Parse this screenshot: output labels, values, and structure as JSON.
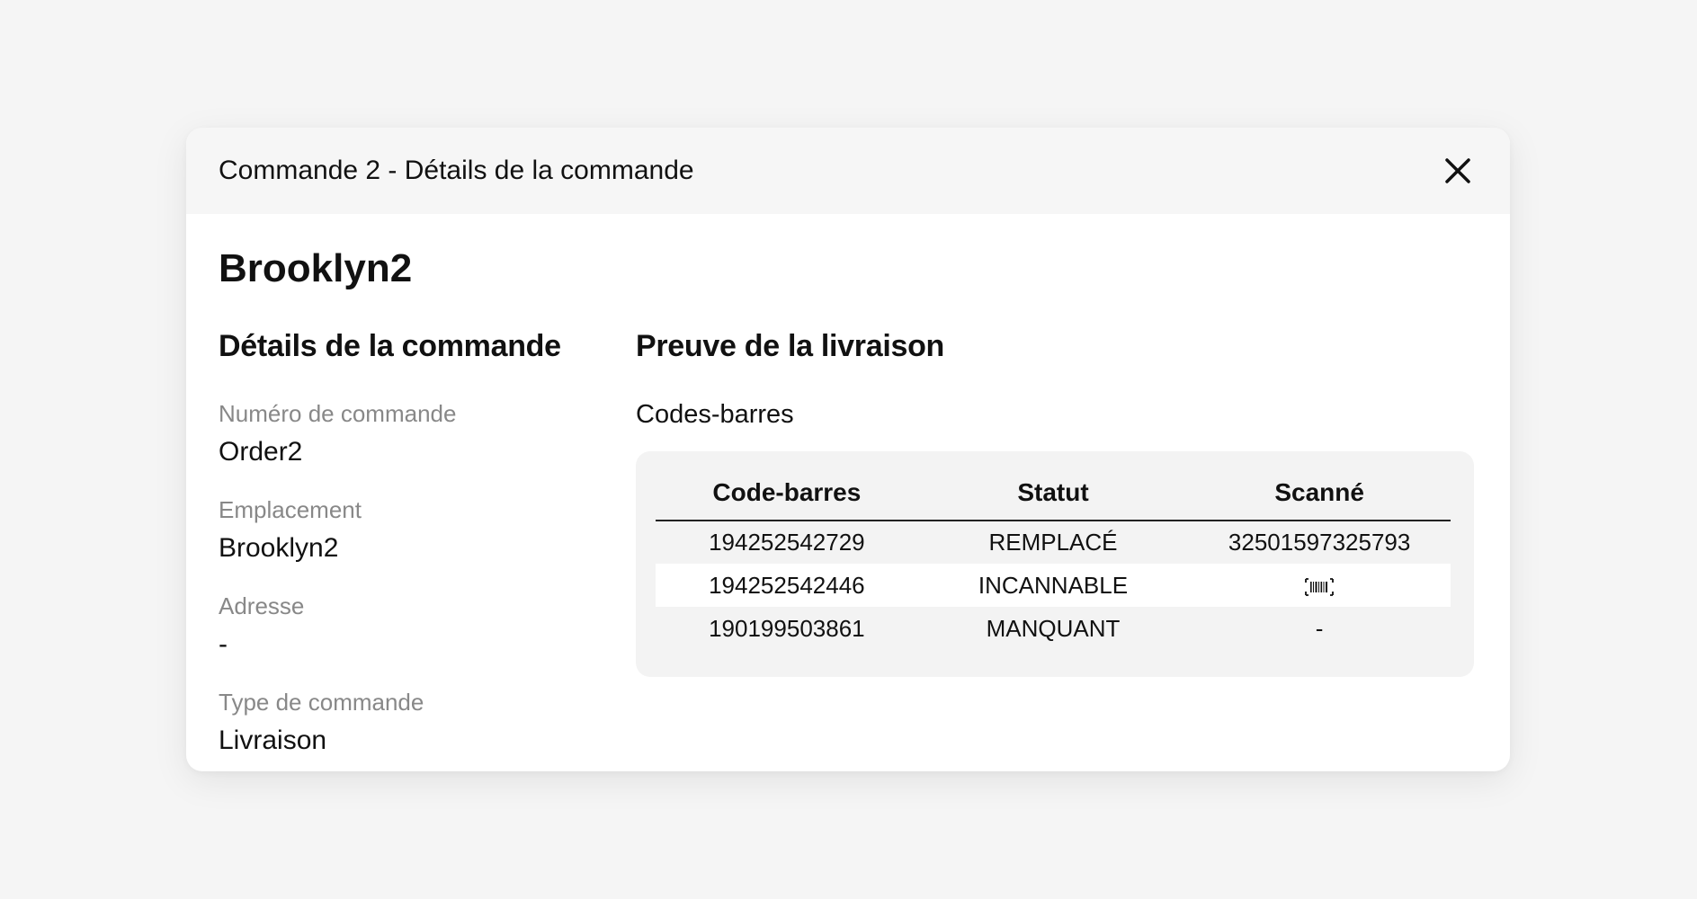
{
  "modal": {
    "title": "Commande 2 - Détails de la commande",
    "location_name": "Brooklyn2"
  },
  "order_details": {
    "heading": "Détails de la commande",
    "fields": [
      {
        "label": "Numéro de commande",
        "value": "Order2"
      },
      {
        "label": "Emplacement",
        "value": "Brooklyn2"
      },
      {
        "label": "Adresse",
        "value": "-"
      },
      {
        "label": "Type de commande",
        "value": "Livraison"
      }
    ]
  },
  "proof": {
    "heading": "Preuve de la livraison",
    "barcodes_label": "Codes-barres",
    "columns": [
      "Code-barres",
      "Statut",
      "Scanné"
    ],
    "rows": [
      {
        "barcode": "194252542729",
        "status": "REMPLACÉ",
        "scanned": "32501597325793"
      },
      {
        "barcode": "194252542446",
        "status": "INCANNABLE",
        "scanned_icon": "barcode-icon"
      },
      {
        "barcode": "190199503861",
        "status": "MANQUANT",
        "scanned": "-"
      }
    ]
  },
  "icons": {
    "close": "close-icon",
    "barcode": "barcode-icon"
  }
}
